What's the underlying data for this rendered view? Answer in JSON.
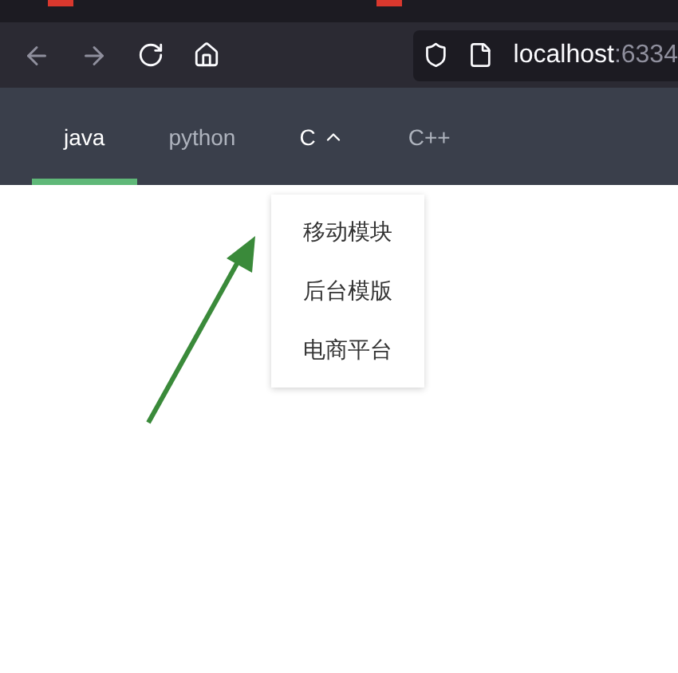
{
  "browser": {
    "address": {
      "host": "localhost",
      "port": ":6334"
    }
  },
  "nav": {
    "tabs": [
      {
        "label": "java",
        "selected": true,
        "kind": "link"
      },
      {
        "label": "python",
        "selected": false,
        "kind": "link"
      },
      {
        "label": "C",
        "selected": false,
        "kind": "dropdown",
        "expanded": true
      },
      {
        "label": "C++",
        "selected": false,
        "kind": "link"
      }
    ]
  },
  "dropdown_menu": {
    "items": [
      "移动模块",
      "后台模版",
      "电商平台"
    ]
  }
}
